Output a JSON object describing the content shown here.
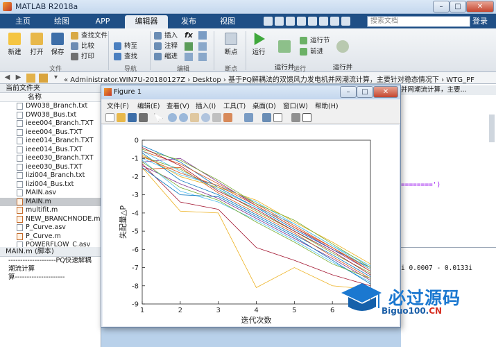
{
  "window": {
    "title": "MATLAB R2018a"
  },
  "tabs": [
    "主页",
    "绘图",
    "APP",
    "编辑器",
    "发布",
    "视图"
  ],
  "active_tab": "编辑器",
  "search_placeholder": "搜索文档",
  "login": "登录",
  "ribbon": {
    "file": {
      "new": "新建",
      "open": "打开",
      "save": "保存",
      "find_files": "查找文件",
      "compare": "比较",
      "print": "打印",
      "group": "文件"
    },
    "navigate": {
      "goto": "转至",
      "find": "查找",
      "group": "导航"
    },
    "edit": {
      "insert": "插入",
      "comment": "注释",
      "indent": "缩进",
      "fx": "fx",
      "group": "编辑"
    },
    "breakpoints": {
      "bp": "断点",
      "group": "断点"
    },
    "run": {
      "run": "运行",
      "run_advance": "运行并\n前进",
      "run_section": "运行节",
      "advance": "前进",
      "run_time": "运行并\n计时",
      "group": "运行"
    }
  },
  "address": {
    "path": "« Administrator.WIN7U-20180127Z › Desktop › 基于PQ解耦法的双馈风力发电机并网潮流计算，主要针对稳态情况下 › WTG_PF"
  },
  "folder": {
    "title": "当前文件夹",
    "column": "名称",
    "files": [
      "DW038_Branch.txt",
      "DW038_Bus.txt",
      "ieee004_Branch.TXT",
      "ieee004_Bus.TXT",
      "ieee014_Branch.TXT",
      "ieee014_Bus.TXT",
      "ieee030_Branch.TXT",
      "ieee030_Bus.TXT",
      "lizi004_Branch.txt",
      "lizi004_Bus.txt",
      "MAIN.asv",
      "MAIN.m",
      "multifit.m",
      "NEW_BRANCHNODE.m",
      "P_Curve.asv",
      "P_Curve.m",
      "POWERFLOW_C.asv"
    ],
    "selected": "MAIN.m"
  },
  "details": {
    "title": "MAIN.m (脚本)",
    "lines": [
      "--------------------PQ快速解耦",
      "潮流计算",
      "算---------------------"
    ]
  },
  "editor_snippet": {
    "tab_text": "并网潮流计算，主要...",
    "code": "========')",
    "cmd": "i    0.0007 - 0.0133i"
  },
  "figure": {
    "title": "Figure 1",
    "menu": [
      "文件(F)",
      "编辑(E)",
      "查看(V)",
      "插入(I)",
      "工具(T)",
      "桌面(D)",
      "窗口(W)",
      "帮助(H)"
    ]
  },
  "chart_data": {
    "type": "line",
    "xlabel": "迭代次数",
    "ylabel": "失配量△P",
    "xlim": [
      1,
      7
    ],
    "ylim": [
      -9,
      0
    ],
    "xticks": [
      "1",
      "2",
      "3",
      "4",
      "5",
      "6"
    ],
    "yticks": [
      "0",
      "-1",
      "-2",
      "-3",
      "-4",
      "-5",
      "-6",
      "-7",
      "-8",
      "-9"
    ],
    "grid": false,
    "series": [
      {
        "color": "#0072bd",
        "values": [
          -0.3,
          -1.2,
          -2.6,
          -3.7,
          -4.9,
          -6.0,
          -7.0
        ]
      },
      {
        "color": "#d95319",
        "values": [
          -0.6,
          -1.3,
          -2.4,
          -3.5,
          -4.7,
          -5.9,
          -7.1
        ]
      },
      {
        "color": "#edb120",
        "values": [
          -1.5,
          -3.9,
          -4.0,
          -8.1,
          -7.0,
          -8.0,
          -8.2
        ]
      },
      {
        "color": "#7e2f8e",
        "values": [
          -1.2,
          -1.0,
          -2.3,
          -3.6,
          -4.8,
          -6.0,
          -7.2
        ]
      },
      {
        "color": "#77ac30",
        "values": [
          -0.9,
          -1.6,
          -2.7,
          -3.9,
          -5.0,
          -6.2,
          -7.3
        ]
      },
      {
        "color": "#4dbeee",
        "values": [
          -1.0,
          -1.9,
          -2.5,
          -3.4,
          -4.6,
          -5.8,
          -6.9
        ]
      },
      {
        "color": "#a2142f",
        "values": [
          -1.3,
          -3.4,
          -3.8,
          -5.9,
          -6.6,
          -7.4,
          -8.0
        ]
      },
      {
        "color": "#0072bd",
        "values": [
          -0.7,
          -2.2,
          -3.0,
          -4.1,
          -5.2,
          -6.3,
          -7.5
        ]
      },
      {
        "color": "#d95319",
        "values": [
          -1.6,
          -1.5,
          -2.9,
          -4.0,
          -5.1,
          -6.4,
          -7.6
        ]
      },
      {
        "color": "#edb120",
        "values": [
          -0.8,
          -2.0,
          -2.6,
          -3.3,
          -4.5,
          -5.6,
          -6.8
        ]
      },
      {
        "color": "#7e2f8e",
        "values": [
          -1.4,
          -2.4,
          -3.2,
          -4.3,
          -5.4,
          -6.5,
          -7.7
        ]
      },
      {
        "color": "#77ac30",
        "values": [
          -0.5,
          -1.1,
          -2.2,
          -3.5,
          -4.4,
          -5.7,
          -7.0
        ]
      },
      {
        "color": "#4dbeee",
        "values": [
          -1.1,
          -2.8,
          -3.4,
          -4.4,
          -5.5,
          -6.7,
          -7.8
        ]
      },
      {
        "color": "#a2142f",
        "values": [
          -0.4,
          -1.4,
          -2.8,
          -3.8,
          -5.0,
          -6.1,
          -7.4
        ]
      },
      {
        "color": "#0072bd",
        "values": [
          -1.5,
          -3.0,
          -3.1,
          -4.2,
          -5.3,
          -6.6,
          -7.9
        ]
      },
      {
        "color": "#d95319",
        "values": [
          -0.9,
          -1.8,
          -2.5,
          -3.6,
          -4.8,
          -5.9,
          -7.2
        ]
      },
      {
        "color": "#77ac30",
        "values": [
          -1.2,
          -2.6,
          -3.3,
          -4.5,
          -5.6,
          -6.8,
          -7.6
        ]
      },
      {
        "color": "#4dbeee",
        "values": [
          -0.6,
          -1.7,
          -2.7,
          -3.7,
          -4.6,
          -5.8,
          -7.1
        ]
      }
    ]
  },
  "watermark": {
    "big": "必过源码",
    "small_blue": "Biguo100.",
    "small_red": "CN"
  }
}
